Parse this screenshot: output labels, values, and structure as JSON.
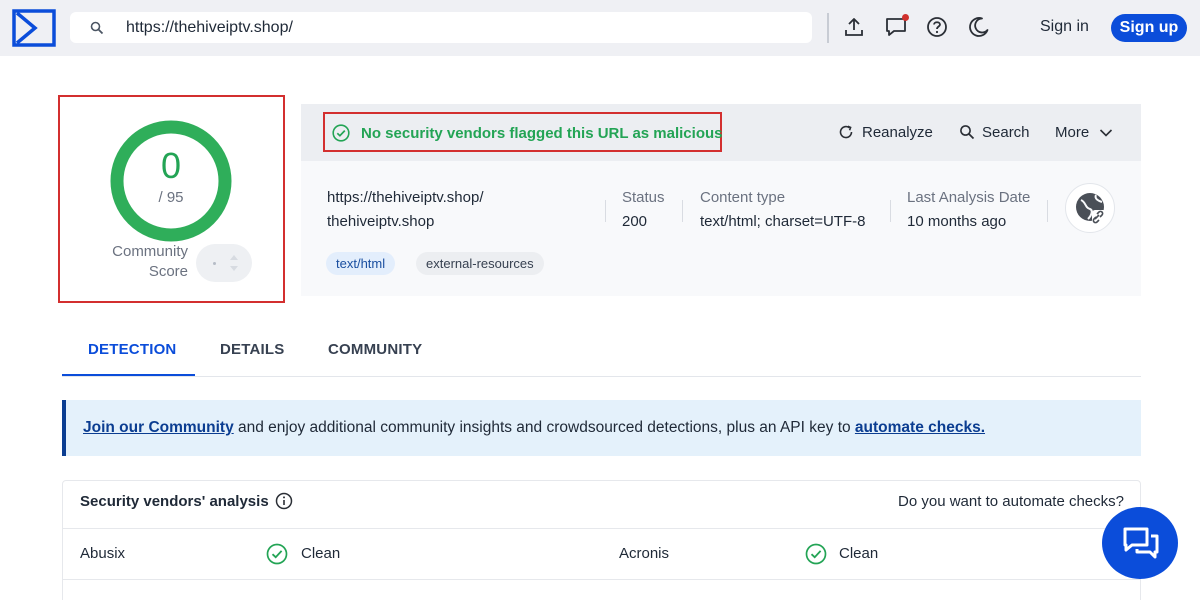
{
  "topbar": {
    "search_value": "https://thehiveiptv.shop/",
    "sign_in": "Sign in",
    "sign_up": "Sign up",
    "icons": [
      "logo-icon",
      "search-icon",
      "upload-icon",
      "notifications-icon",
      "help-icon",
      "dark-mode-icon"
    ]
  },
  "score": {
    "value": "0",
    "total": "/ 95",
    "community_label": "Community Score"
  },
  "panel": {
    "verdict": "No security vendors flagged this URL as malicious",
    "actions": {
      "reanalyze": "Reanalyze",
      "search": "Search",
      "more": "More"
    },
    "url": "https://thehiveiptv.shop/",
    "domain": "thehiveiptv.shop",
    "status_label": "Status",
    "status_value": "200",
    "content_type_label": "Content type",
    "content_type_value": "text/html; charset=UTF-8",
    "last_analysis_label": "Last Analysis Date",
    "last_analysis_value": "10 months ago",
    "tags": [
      "text/html",
      "external-resources"
    ]
  },
  "tabs": {
    "detection": "DETECTION",
    "details": "DETAILS",
    "community": "COMMUNITY",
    "active": "detection"
  },
  "banner": {
    "link1": "Join our Community",
    "middle": " and enjoy additional community insights and crowdsourced detections, plus an API key to ",
    "link2": "automate checks."
  },
  "vendors": {
    "title": "Security vendors' analysis",
    "automate_prompt": "Do you want to automate checks?",
    "rows": [
      {
        "left": {
          "name": "Abusix",
          "result": "Clean"
        },
        "right": {
          "name": "Acronis",
          "result": "Clean"
        }
      }
    ]
  },
  "colors": {
    "accent": "#0b4dda",
    "clean": "#23a455",
    "highlight_box": "#d32f2f",
    "banner_bg": "#e4f1fb"
  }
}
